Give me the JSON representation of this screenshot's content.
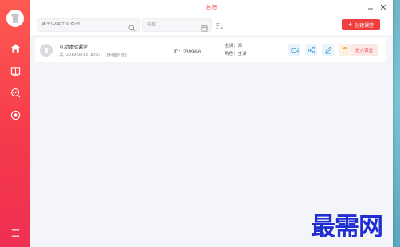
{
  "window": {
    "title": "首页"
  },
  "toolbar": {
    "search_placeholder": "课堂ID或主页名称",
    "filter_value": "全部",
    "create_label": "创建课堂"
  },
  "classes": [
    {
      "name": "互动体验课堂",
      "date": "2019-03-18 10:51",
      "duration": "[不限时长]",
      "id_text": "ID：2399W6",
      "host": "主讲：海",
      "role": "角色：主讲",
      "enter_label": "进入课堂"
    }
  ],
  "watermark": "最需网",
  "colors": {
    "accent": "#f03d3d",
    "sidebar_top": "#ff5a52",
    "sidebar_bottom": "#ef2f52",
    "action_blue": "#3a9bd9",
    "action_orange": "#f0a030"
  }
}
